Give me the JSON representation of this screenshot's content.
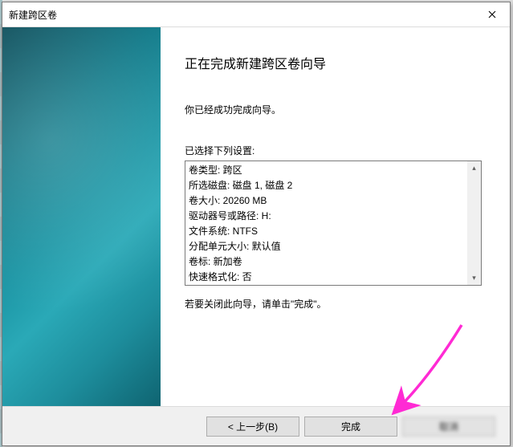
{
  "window": {
    "title": "新建跨区卷"
  },
  "content": {
    "heading": "正在完成新建跨区卷向导",
    "you_completed": "你已经成功完成向导。",
    "settings_label": "已选择下列设置:",
    "settings_lines": [
      "卷类型: 跨区",
      "所选磁盘: 磁盘 1, 磁盘 2",
      "卷大小: 20260 MB",
      "驱动器号或路径: H:",
      "文件系统: NTFS",
      "分配单元大小: 默认值",
      "卷标: 新加卷",
      "快速格式化: 否"
    ],
    "closing_hint": "若要关闭此向导，请单击\"完成\"。"
  },
  "footer": {
    "back_label": "< 上一步(B)",
    "finish_label": "完成",
    "cancel_label": "取消"
  }
}
